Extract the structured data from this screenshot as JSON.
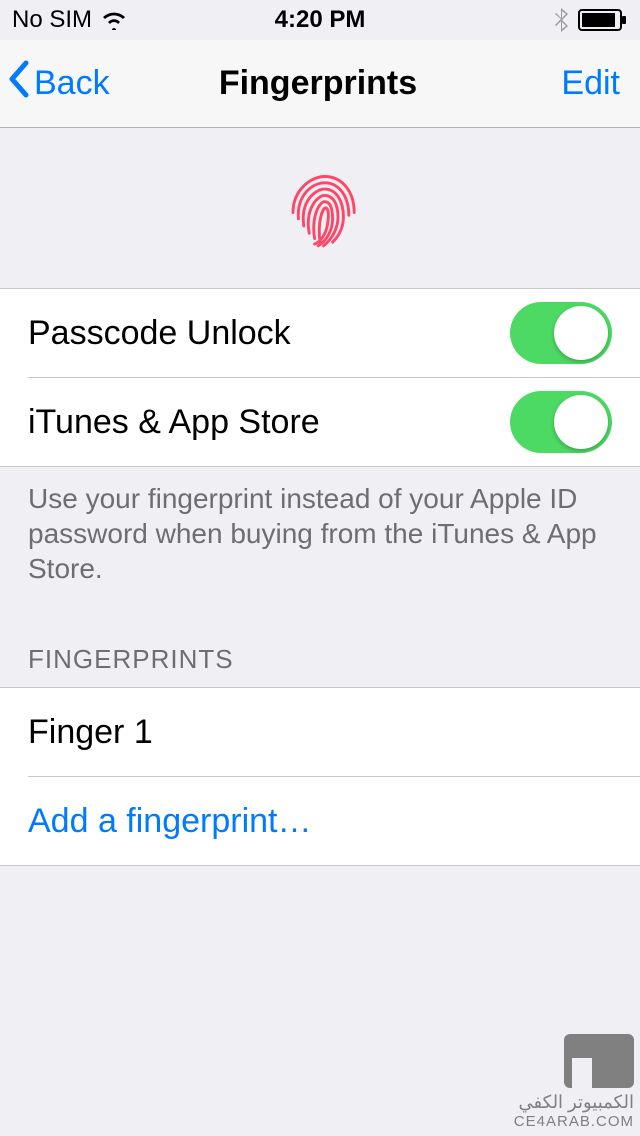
{
  "status": {
    "carrier": "No SIM",
    "time": "4:20 PM"
  },
  "nav": {
    "back_label": "Back",
    "title": "Fingerprints",
    "edit_label": "Edit"
  },
  "toggles": {
    "passcode": {
      "label": "Passcode Unlock",
      "on": true
    },
    "itunes": {
      "label": "iTunes & App Store",
      "on": true
    }
  },
  "footer": "Use your fingerprint instead of your Apple ID password when buying from the iTunes & App Store.",
  "fingerprints": {
    "header": "FINGERPRINTS",
    "items": [
      {
        "label": "Finger 1"
      }
    ],
    "add_label": "Add a fingerprint…"
  },
  "colors": {
    "accent": "#007aff",
    "toggle_on": "#4cd964",
    "fingerprint": "#ff4666"
  },
  "watermark": {
    "line1": "الكمبيوتر الكفي",
    "line2": "CE4ARAB.COM"
  }
}
